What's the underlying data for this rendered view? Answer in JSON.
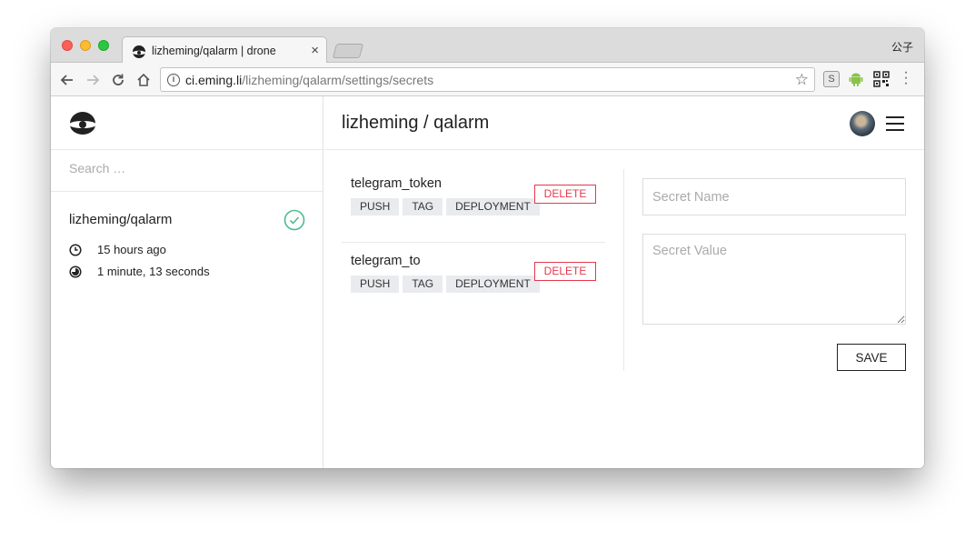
{
  "browser": {
    "tab_title": "lizheming/qalarm | drone",
    "tab_close": "×",
    "profile_name": "公子",
    "url_host": "ci.eming.li",
    "url_path": "/lizheming/qalarm/settings/secrets",
    "ext_s_label": "S"
  },
  "sidebar": {
    "search_placeholder": "Search …",
    "repo": {
      "name": "lizheming/qalarm",
      "status": "success",
      "status_color": "#4dbb8f",
      "started": "15 hours ago",
      "duration": "1 minute, 13 seconds"
    }
  },
  "header": {
    "title": "lizheming / qalarm"
  },
  "secrets": [
    {
      "name": "telegram_token",
      "events": [
        "PUSH",
        "TAG",
        "DEPLOYMENT"
      ],
      "delete_label": "DELETE"
    },
    {
      "name": "telegram_to",
      "events": [
        "PUSH",
        "TAG",
        "DEPLOYMENT"
      ],
      "delete_label": "DELETE"
    }
  ],
  "form": {
    "name_placeholder": "Secret Name",
    "value_placeholder": "Secret Value",
    "save_label": "SAVE"
  },
  "colors": {
    "danger": "#e4394d",
    "success": "#4dbb8f"
  }
}
